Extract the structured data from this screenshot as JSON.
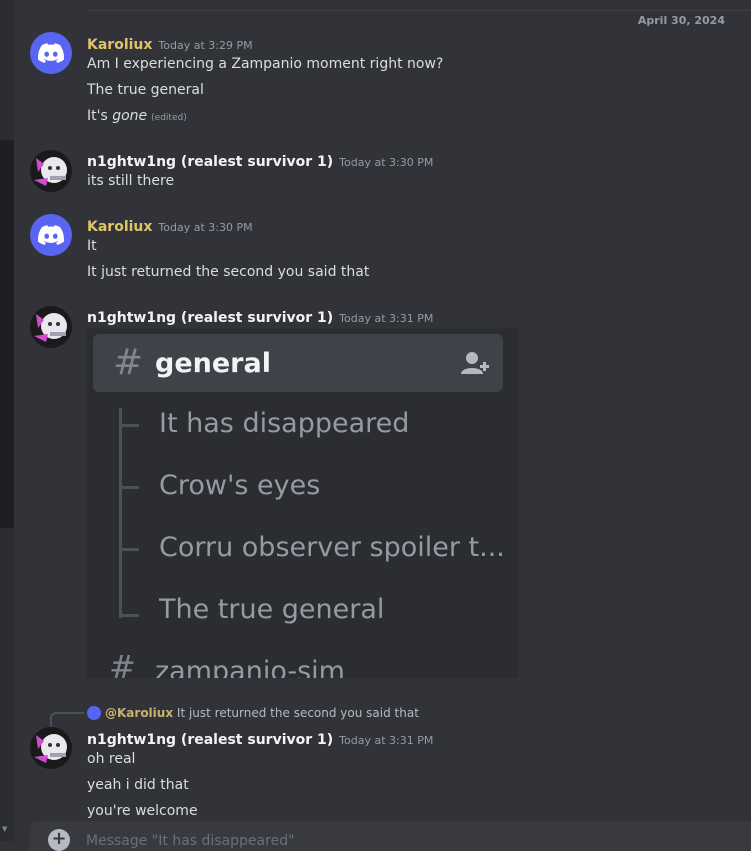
{
  "date_divider": "April 30, 2024",
  "messages": [
    {
      "author": "Karoliux",
      "time": "Today at 3:29 PM",
      "lines": [
        "Am I experiencing a Zampanio moment right now?",
        "The true general"
      ],
      "italic_line": {
        "prefix": "It's ",
        "italic": "gone",
        "edited": "(edited)"
      }
    },
    {
      "author": "n1ghtw1ng (realest survivor 1)",
      "time": "Today at 3:30 PM",
      "lines": [
        "its still there"
      ]
    },
    {
      "author": "Karoliux",
      "time": "Today at 3:30 PM",
      "lines": [
        "It",
        "It just returned the second you said that"
      ]
    },
    {
      "author": "n1ghtw1ng (realest survivor 1)",
      "time": "Today at 3:31 PM"
    },
    {
      "author": "n1ghtw1ng (realest survivor 1)",
      "time": "Today at 3:31 PM",
      "lines": [
        "oh real",
        "yeah i did that",
        "you're welcome"
      ]
    }
  ],
  "embed": {
    "channel": "general",
    "threads": [
      "It has disappeared",
      "Crow's eyes",
      "Corru observer spoiler t...",
      "The true general"
    ],
    "next_channel": "zampanio-sim"
  },
  "reply": {
    "mention": "@Karoliux",
    "text": "It just returned the second you said that"
  },
  "input": {
    "placeholder": "Message \"It has disappeared\""
  },
  "icons": {
    "discord_avatar": "discord-logo-icon",
    "add_member": "add-member-icon",
    "plus": "plus-icon"
  },
  "colors": {
    "background": "#313338",
    "karoliux_name": "#e0c46c",
    "discord_blurple": "#5865f2"
  }
}
